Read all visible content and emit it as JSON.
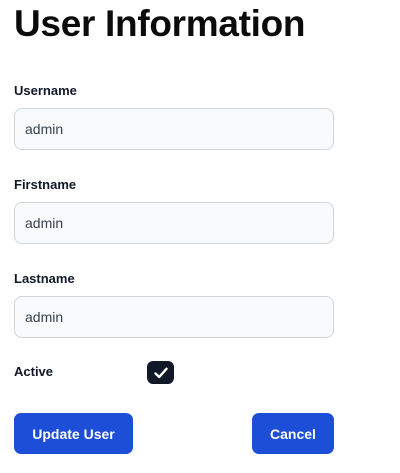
{
  "page": {
    "title": "User Information"
  },
  "form": {
    "username": {
      "label": "Username",
      "value": "admin"
    },
    "firstname": {
      "label": "Firstname",
      "value": "admin"
    },
    "lastname": {
      "label": "Lastname",
      "value": "admin"
    },
    "active": {
      "label": "Active",
      "checked": true,
      "icon": "check-icon"
    }
  },
  "actions": {
    "update_label": "Update User",
    "cancel_label": "Cancel"
  },
  "colors": {
    "primary_button": "#1d4ed8",
    "checkbox_fill": "#111827",
    "input_background": "#f9fafb",
    "input_border": "#d1d5db"
  }
}
